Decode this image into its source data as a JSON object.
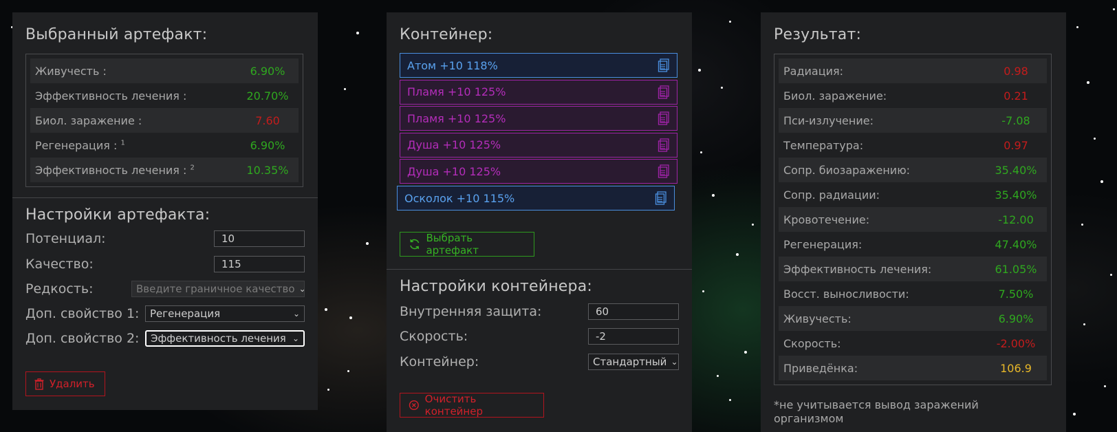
{
  "colors": {
    "positive": "#2fa81f",
    "negative": "#c41c1c",
    "highlight": "#e8b829",
    "blue_slot": "#4a8fe0",
    "purple_slot": "#a023a8"
  },
  "artifact": {
    "title": "Выбранный артефакт:",
    "stats": [
      {
        "label": "Живучесть :",
        "sup": "",
        "value": "6.90%",
        "tone": "positive"
      },
      {
        "label": "Эффективность лечения :",
        "sup": "",
        "value": "20.70%",
        "tone": "positive"
      },
      {
        "label": "Биол. заражение :",
        "sup": "",
        "value": "7.60",
        "tone": "negative"
      },
      {
        "label": "Регенерация :",
        "sup": "1",
        "value": "6.90%",
        "tone": "positive"
      },
      {
        "label": "Эффективность лечения :",
        "sup": "2",
        "value": "10.35%",
        "tone": "positive"
      }
    ]
  },
  "artifact_settings": {
    "title": "Настройки артефакта:",
    "potential_label": "Потенциал:",
    "potential_value": "10",
    "quality_label": "Качество:",
    "quality_value": "115",
    "rarity_label": "Редкость:",
    "rarity_value": "Введите граничное качество",
    "extra1_label": "Доп. свойство 1:",
    "extra1_value": "Регенерация",
    "extra2_label": "Доп. свойство 2:",
    "extra2_value": "Эффективность лечения",
    "delete_label": "Удалить"
  },
  "container": {
    "title": "Контейнер:",
    "slots": [
      {
        "label": "Атом +10 118%",
        "style": "blue"
      },
      {
        "label": "Пламя +10 125%",
        "style": "purple"
      },
      {
        "label": "Пламя +10 125%",
        "style": "purple"
      },
      {
        "label": "Душа +10 125%",
        "style": "purple"
      },
      {
        "label": "Душа +10 125%",
        "style": "purple"
      },
      {
        "label": "Осколок +10 115%",
        "style": "blue"
      }
    ],
    "select_button": "Выбрать артефакт"
  },
  "container_settings": {
    "title": "Настройки контейнера:",
    "protection_label": "Внутренняя защита:",
    "protection_value": "60",
    "speed_label": "Скорость:",
    "speed_value": "-2",
    "container_label": "Контейнер:",
    "container_value": "Стандартный",
    "clear_button": "Очистить контейнер"
  },
  "result": {
    "title": "Результат:",
    "stats": [
      {
        "label": "Радиация:",
        "value": "0.98",
        "tone": "negative"
      },
      {
        "label": "Биол. заражение:",
        "value": "0.21",
        "tone": "negative"
      },
      {
        "label": "Пси-излучение:",
        "value": "-7.08",
        "tone": "positive"
      },
      {
        "label": "Температура:",
        "value": "0.97",
        "tone": "negative"
      },
      {
        "label": "Сопр. биозаражению:",
        "value": "35.40%",
        "tone": "positive"
      },
      {
        "label": "Сопр. радиации:",
        "value": "35.40%",
        "tone": "positive"
      },
      {
        "label": "Кровотечение:",
        "value": "-12.00",
        "tone": "positive"
      },
      {
        "label": "Регенерация:",
        "value": "47.40%",
        "tone": "positive"
      },
      {
        "label": "Эффективность лечения:",
        "value": "61.05%",
        "tone": "positive"
      },
      {
        "label": "Восст. выносливости:",
        "value": "7.50%",
        "tone": "positive"
      },
      {
        "label": "Живучесть:",
        "value": "6.90%",
        "tone": "positive"
      },
      {
        "label": "Скорость:",
        "value": "-2.00%",
        "tone": "negative"
      },
      {
        "label": "Приведёнка:",
        "value": "106.9",
        "tone": "highlight"
      }
    ],
    "note": "*не учитывается вывод заражений организмом"
  }
}
